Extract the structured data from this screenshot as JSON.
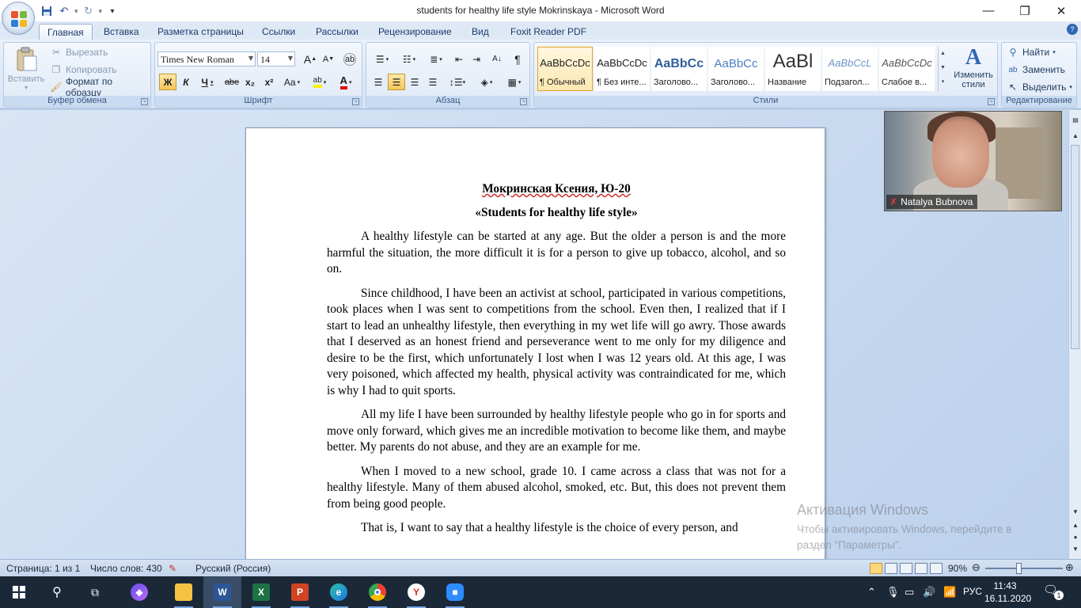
{
  "window": {
    "title": "students for healthy life style Mokrinskaya - Microsoft Word",
    "minimize": "—",
    "restore": "❐",
    "close": "✕"
  },
  "qat": {
    "save_icon": "save-icon",
    "undo_icon": "undo-icon",
    "redo_icon": "redo-icon"
  },
  "tabs": [
    "Главная",
    "Вставка",
    "Разметка страницы",
    "Ссылки",
    "Рассылки",
    "Рецензирование",
    "Вид",
    "Foxit Reader PDF"
  ],
  "ribbon": {
    "clipboard": {
      "label": "Буфер обмена",
      "paste": "Вставить",
      "cut": "Вырезать",
      "copy": "Копировать",
      "format_painter": "Формат по образцу"
    },
    "font": {
      "label": "Шрифт",
      "font_name": "Times New Roman",
      "font_size": "14",
      "bold": "Ж",
      "italic": "К",
      "underline": "Ч",
      "strike": "abe",
      "subscript": "x₂",
      "superscript": "x²",
      "case": "Aa",
      "grow": "A",
      "shrink": "A",
      "font_color": "A"
    },
    "paragraph": {
      "label": "Абзац"
    },
    "styles": {
      "label": "Стили",
      "items": [
        {
          "sample": "AaBbCcDc",
          "name": "¶ Обычный"
        },
        {
          "sample": "AaBbCcDc",
          "name": "¶ Без инте..."
        },
        {
          "sample": "AaBbCc",
          "name": "Заголово..."
        },
        {
          "sample": "AaBbCc",
          "name": "Заголово..."
        },
        {
          "sample": "AaBl",
          "name": "Название"
        },
        {
          "sample": "AaBbCcL",
          "name": "Подзагол..."
        },
        {
          "sample": "AaBbCcDc",
          "name": "Слабое в..."
        }
      ],
      "change_styles": "Изменить стили"
    },
    "editing": {
      "label": "Редактирование",
      "find": "Найти",
      "replace": "Заменить",
      "select": "Выделить"
    }
  },
  "document": {
    "title_line": "Мокринская Ксения, Ю-20",
    "subtitle": "«Students for healthy life style»",
    "paragraphs": [
      "A healthy lifestyle can be started at any age. But the older a person is and the more harmful the situation, the more difficult it is for a person to give up tobacco, alcohol, and so on.",
      "Since childhood, I have been an activist at school, participated in various competitions, took places when I was sent to competitions from the school. Even then, I realized that if I start to lead an unhealthy lifestyle, then everything in my wet life will go awry. Those awards that I deserved as an honest friend and perseverance went to me only for my diligence and desire to be the first, which unfortunately I lost when I was 12 years old. At this age, I was very poisoned, which affected my health, physical activity was contraindicated for me, which is why I had to quit sports.",
      "All my life I have been surrounded by healthy lifestyle people who go in for sports and move only forward, which gives me an incredible motivation to become like them, and maybe better. My parents do not abuse, and they are an example for me.",
      "When I moved to a new school, grade 10. I came across a class that was not for a healthy lifestyle. Many of them abused alcohol, smoked, etc. But, this does not prevent them from being good people.",
      "That is, I want to say that a healthy lifestyle is the choice of every person, and"
    ]
  },
  "watermark": {
    "title": "Активация Windows",
    "line1": "Чтобы активировать Windows, перейдите в",
    "line2": "раздел \"Параметры\"."
  },
  "video": {
    "name": "Natalya Bubnova"
  },
  "status": {
    "page": "Страница: 1 из 1",
    "words": "Число слов: 430",
    "language": "Русский (Россия)",
    "zoom": "90%"
  },
  "taskbar": {
    "apps": [
      "windows-start",
      "search",
      "task-view",
      "alice",
      "file-explorer",
      "word",
      "excel",
      "powerpoint",
      "edge",
      "chrome",
      "yandex-browser",
      "zoom"
    ],
    "language": "РУС",
    "time": "11:43",
    "date": "16.11.2020",
    "notification_count": "1"
  }
}
